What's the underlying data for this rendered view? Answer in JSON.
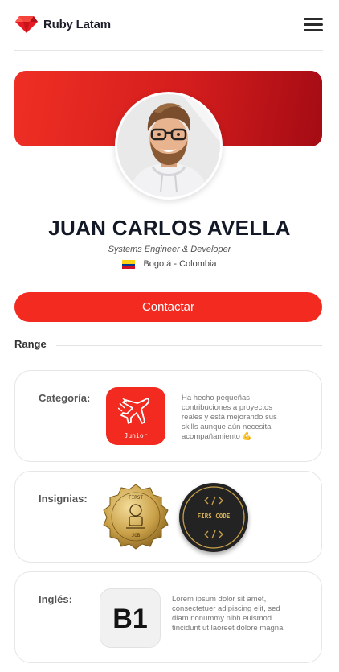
{
  "header": {
    "brand": "Ruby Latam",
    "logo_icon": "ruby-gem-icon",
    "menu_icon": "hamburger-icon"
  },
  "profile": {
    "name": "JUAN CARLOS AVELLA",
    "role": "Systems Engineer & Developer",
    "location": "Bogotá - Colombia",
    "flag_icon": "colombia-flag-icon",
    "banner_color": "#e0231f"
  },
  "contact_button": {
    "label": "Contactar",
    "color": "#f22a1f"
  },
  "range": {
    "label": "Range"
  },
  "cards": {
    "category": {
      "label": "Categoría:",
      "badge_text": "Junior",
      "badge_icon": "airplane-icon",
      "description": "Ha hecho pequeñas contribuciones a proyectos reales y está mejorando sus skills aunque aún necesita acompañamiento 💪"
    },
    "badges": {
      "label": "Insignias:",
      "badge1": {
        "top_text": "FIRST",
        "bottom_text": "JOB"
      },
      "badge2": {
        "text": "FIRS CODE"
      }
    },
    "english": {
      "label": "Inglés:",
      "level": "B1",
      "description": "Lorem ipsum dolor sit amet, consectetuer adipiscing elit, sed diam nonummy nibh euismod tincidunt ut laoreet dolore magna"
    }
  }
}
